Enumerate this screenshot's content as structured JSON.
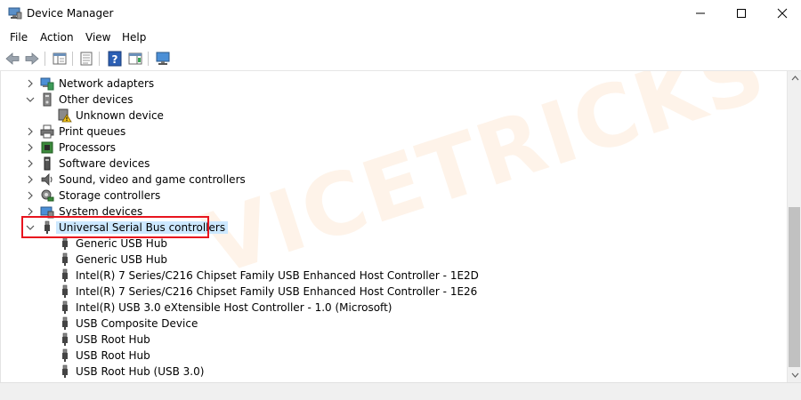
{
  "window": {
    "title": "Device Manager"
  },
  "menu": [
    "File",
    "Action",
    "View",
    "Help"
  ],
  "watermark": "VICETRICKS",
  "tree": [
    {
      "label": "Network adapters",
      "icon": "network-adapter-icon",
      "expander": "collapsed"
    },
    {
      "label": "Other devices",
      "icon": "other-devices-icon",
      "expander": "expanded"
    },
    {
      "label": "Unknown device",
      "icon": "unknown-device-warning-icon",
      "expander": "none"
    },
    {
      "label": "Print queues",
      "icon": "printer-icon",
      "expander": "collapsed"
    },
    {
      "label": "Processors",
      "icon": "processor-icon",
      "expander": "collapsed"
    },
    {
      "label": "Software devices",
      "icon": "software-device-icon",
      "expander": "collapsed"
    },
    {
      "label": "Sound, video and game controllers",
      "icon": "speaker-icon",
      "expander": "collapsed"
    },
    {
      "label": "Storage controllers",
      "icon": "storage-controller-icon",
      "expander": "collapsed"
    },
    {
      "label": "System devices",
      "icon": "system-device-icon",
      "expander": "collapsed"
    },
    {
      "label": "Universal Serial Bus controllers",
      "icon": "usb-plug-icon",
      "expander": "expanded",
      "selected": true
    },
    {
      "label": "Generic USB Hub",
      "icon": "usb-plug-icon",
      "expander": "none"
    },
    {
      "label": "Generic USB Hub",
      "icon": "usb-plug-icon",
      "expander": "none"
    },
    {
      "label": "Intel(R) 7 Series/C216 Chipset Family USB Enhanced Host Controller - 1E2D",
      "icon": "usb-plug-icon",
      "expander": "none"
    },
    {
      "label": "Intel(R) 7 Series/C216 Chipset Family USB Enhanced Host Controller - 1E26",
      "icon": "usb-plug-icon",
      "expander": "none"
    },
    {
      "label": "Intel(R) USB 3.0 eXtensible Host Controller - 1.0 (Microsoft)",
      "icon": "usb-plug-icon",
      "expander": "none"
    },
    {
      "label": "USB Composite Device",
      "icon": "usb-plug-icon",
      "expander": "none"
    },
    {
      "label": "USB Root Hub",
      "icon": "usb-plug-icon",
      "expander": "none"
    },
    {
      "label": "USB Root Hub",
      "icon": "usb-plug-icon",
      "expander": "none"
    },
    {
      "label": "USB Root Hub (USB 3.0)",
      "icon": "usb-plug-icon",
      "expander": "none"
    }
  ],
  "colors": {
    "selection": "#cce8ff",
    "highlight_box": "#e8141e",
    "watermark": "#f28c28"
  }
}
